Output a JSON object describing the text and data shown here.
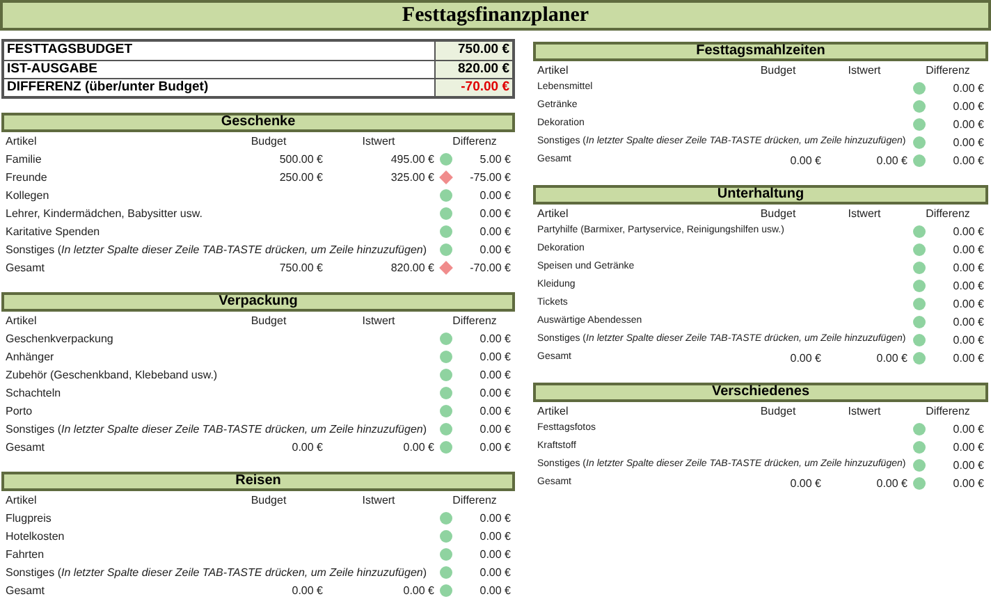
{
  "title": "Festtagsfinanzplaner",
  "summary": [
    {
      "label": "FESTTAGSBUDGET",
      "value": "750.00 €",
      "alert": false
    },
    {
      "label": "IST-AUSGABE",
      "value": "820.00 €",
      "alert": false
    },
    {
      "label": "DIFFERENZ (über/unter Budget)",
      "value": "-70.00 €",
      "alert": true
    }
  ],
  "left_sections": [
    {
      "title": "Geschenke",
      "columns": [
        "Artikel",
        "Budget",
        "Istwert",
        "Differenz"
      ],
      "rows": [
        {
          "item": "Familie",
          "budget": "500.00 €",
          "actual": "495.00 €",
          "over_budget": false,
          "difference": "5.00 €"
        },
        {
          "item": "Freunde",
          "budget": "250.00 €",
          "actual": "325.00 €",
          "over_budget": true,
          "difference": "-75.00 €"
        },
        {
          "item": "Kollegen",
          "over_budget": false,
          "difference": "0.00 €"
        },
        {
          "item": "Lehrer, Kindermädchen, Babysitter usw.",
          "over_budget": false,
          "difference": "0.00 €"
        },
        {
          "item": "Karitative Spenden",
          "over_budget": false,
          "difference": "0.00 €"
        },
        {
          "item": "Sonstiges (*In letzter Spalte dieser Zeile TAB-TASTE drücken, um Zeile hinzuzufügen*)",
          "over_budget": false,
          "difference": "0.00 €"
        },
        {
          "item": "Gesamt",
          "budget": "750.00 €",
          "actual": "820.00 €",
          "over_budget": true,
          "difference": "-70.00 €"
        }
      ]
    },
    {
      "title": "Verpackung",
      "columns": [
        "Artikel",
        "Budget",
        "Istwert",
        "Differenz"
      ],
      "rows": [
        {
          "item": "Geschenkverpackung",
          "over_budget": false,
          "difference": "0.00 €"
        },
        {
          "item": "Anhänger",
          "over_budget": false,
          "difference": "0.00 €"
        },
        {
          "item": "Zubehör (Geschenkband, Klebeband usw.)",
          "over_budget": false,
          "difference": "0.00 €"
        },
        {
          "item": "Schachteln",
          "over_budget": false,
          "difference": "0.00 €"
        },
        {
          "item": "Porto",
          "over_budget": false,
          "difference": "0.00 €"
        },
        {
          "item": "Sonstiges (*In letzter Spalte dieser Zeile TAB-TASTE drücken, um Zeile hinzuzufügen*)",
          "over_budget": false,
          "difference": "0.00 €"
        },
        {
          "item": "Gesamt",
          "budget": "0.00 €",
          "actual": "0.00 €",
          "over_budget": false,
          "difference": "0.00 €"
        }
      ]
    },
    {
      "title": "Reisen",
      "columns": [
        "Artikel",
        "Budget",
        "Istwert",
        "Differenz"
      ],
      "rows": [
        {
          "item": "Flugpreis",
          "over_budget": false,
          "difference": "0.00 €"
        },
        {
          "item": "Hotelkosten",
          "over_budget": false,
          "difference": "0.00 €"
        },
        {
          "item": "Fahrten",
          "over_budget": false,
          "difference": "0.00 €"
        },
        {
          "item": "Sonstiges (*In letzter Spalte dieser Zeile TAB-TASTE drücken, um Zeile hinzuzufügen*)",
          "over_budget": false,
          "difference": "0.00 €"
        },
        {
          "item": "Gesamt",
          "budget": "0.00 €",
          "actual": "0.00 €",
          "over_budget": false,
          "difference": "0.00 €"
        }
      ]
    }
  ],
  "right_sections": [
    {
      "title": "Festtagsmahlzeiten",
      "columns": [
        "Artikel",
        "Budget",
        "Istwert",
        "Differenz"
      ],
      "rows": [
        {
          "item": "Lebensmittel",
          "over_budget": false,
          "difference": "0.00 €"
        },
        {
          "item": "Getränke",
          "over_budget": false,
          "difference": "0.00 €"
        },
        {
          "item": "Dekoration",
          "over_budget": false,
          "difference": "0.00 €"
        },
        {
          "item": "Sonstiges (*In letzter Spalte dieser Zeile TAB-TASTE drücken, um Zeile hinzuzufügen*)",
          "over_budget": false,
          "difference": "0.00 €"
        },
        {
          "item": "Gesamt",
          "budget": "0.00 €",
          "actual": "0.00 €",
          "over_budget": false,
          "difference": "0.00 €"
        }
      ]
    },
    {
      "title": "Unterhaltung",
      "columns": [
        "Artikel",
        "Budget",
        "Istwert",
        "Differenz"
      ],
      "rows": [
        {
          "item": "Partyhilfe (Barmixer, Partyservice, Reinigungshilfen usw.)",
          "over_budget": false,
          "difference": "0.00 €"
        },
        {
          "item": "Dekoration",
          "over_budget": false,
          "difference": "0.00 €"
        },
        {
          "item": "Speisen und Getränke",
          "over_budget": false,
          "difference": "0.00 €"
        },
        {
          "item": "Kleidung",
          "over_budget": false,
          "difference": "0.00 €"
        },
        {
          "item": "Tickets",
          "over_budget": false,
          "difference": "0.00 €"
        },
        {
          "item": "Auswärtige Abendessen",
          "over_budget": false,
          "difference": "0.00 €"
        },
        {
          "item": "Sonstiges (*In letzter Spalte dieser Zeile TAB-TASTE drücken, um Zeile hinzuzufügen*)",
          "over_budget": false,
          "difference": "0.00 €"
        },
        {
          "item": "Gesamt",
          "budget": "0.00 €",
          "actual": "0.00 €",
          "over_budget": false,
          "difference": "0.00 €"
        }
      ]
    },
    {
      "title": "Verschiedenes",
      "columns": [
        "Artikel",
        "Budget",
        "Istwert",
        "Differenz"
      ],
      "rows": [
        {
          "item": "Festtagsfotos",
          "over_budget": false,
          "difference": "0.00 €"
        },
        {
          "item": "Kraftstoff",
          "over_budget": false,
          "difference": "0.00 €"
        },
        {
          "item": "Sonstiges (*In letzter Spalte dieser Zeile TAB-TASTE drücken, um Zeile hinzuzufügen*)",
          "over_budget": false,
          "difference": "0.00 €"
        },
        {
          "item": "Gesamt",
          "budget": "0.00 €",
          "actual": "0.00 €",
          "over_budget": false,
          "difference": "0.00 €"
        }
      ]
    }
  ]
}
